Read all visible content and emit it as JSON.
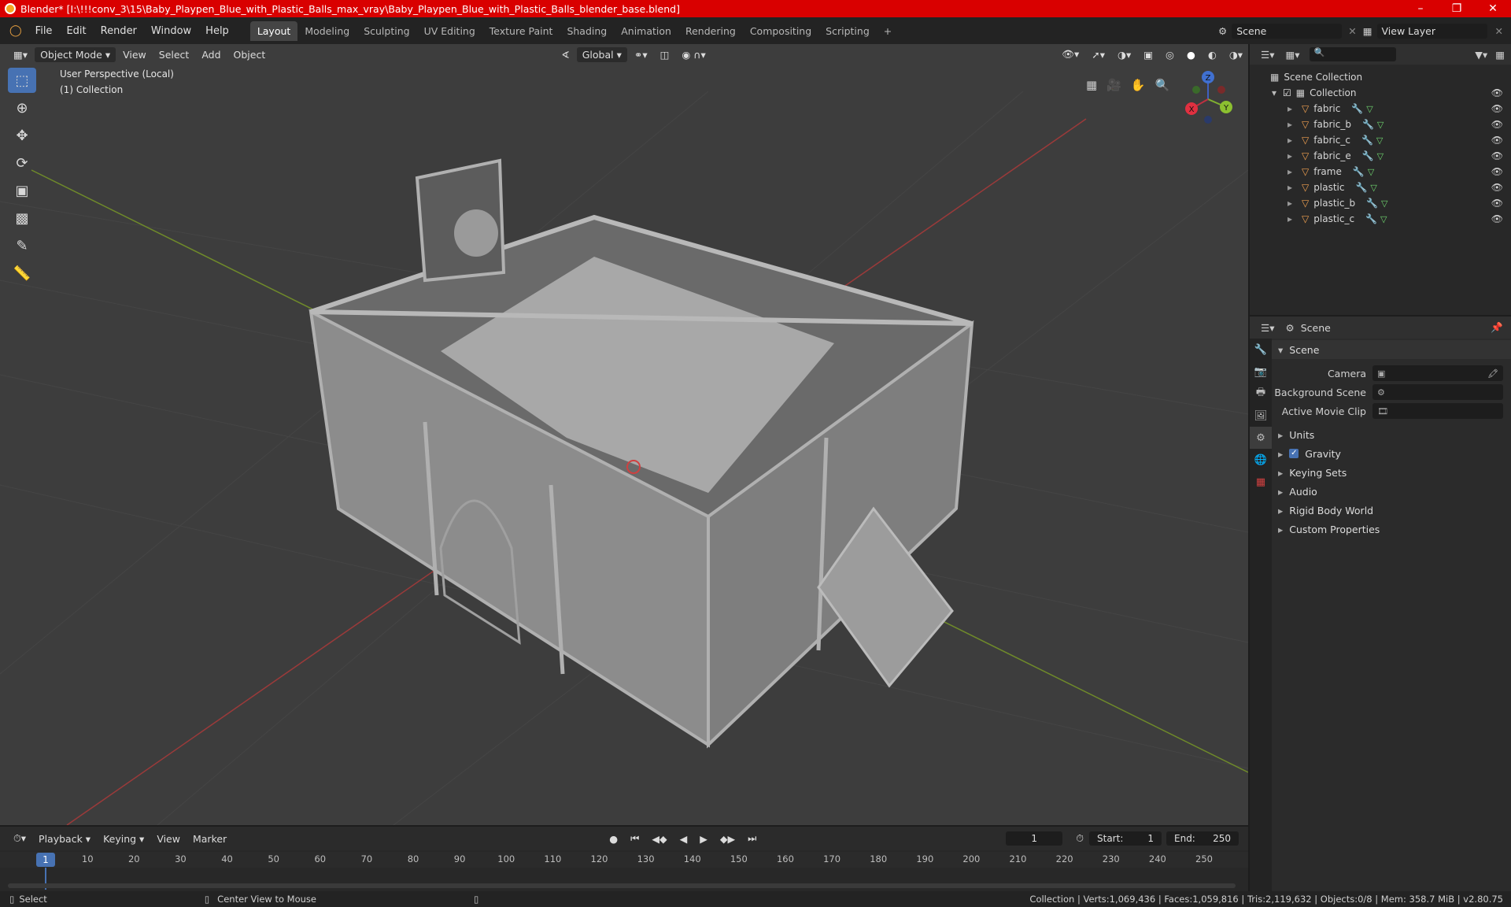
{
  "title": "Blender* [I:\\!!!conv_3\\15\\Baby_Playpen_Blue_with_Plastic_Balls_max_vray\\Baby_Playpen_Blue_with_Plastic_Balls_blender_base.blend]",
  "menu": [
    "File",
    "Edit",
    "Render",
    "Window",
    "Help"
  ],
  "workspaces": [
    "Layout",
    "Modeling",
    "Sculpting",
    "UV Editing",
    "Texture Paint",
    "Shading",
    "Animation",
    "Rendering",
    "Compositing",
    "Scripting"
  ],
  "scene_field": "Scene",
  "view_layer_field": "View Layer",
  "viewport": {
    "mode": "Object Mode",
    "menus": [
      "View",
      "Select",
      "Add",
      "Object"
    ],
    "orientation": "Global",
    "overlay_line1": "User Perspective (Local)",
    "overlay_line2": "(1) Collection",
    "gizmo": {
      "x": "X",
      "y": "Y",
      "z": "Z"
    }
  },
  "outliner": {
    "root": "Scene Collection",
    "collection": "Collection",
    "objects": [
      "fabric",
      "fabric_b",
      "fabric_c",
      "fabric_e",
      "frame",
      "plastic",
      "plastic_b",
      "plastic_c"
    ]
  },
  "properties": {
    "header": "Scene",
    "panel": "Scene",
    "camera_label": "Camera",
    "bg_scene_label": "Background Scene",
    "movie_clip_label": "Active Movie Clip",
    "sections": [
      "Units",
      "Gravity",
      "Keying Sets",
      "Audio",
      "Rigid Body World",
      "Custom Properties"
    ]
  },
  "timeline": {
    "menus": [
      "Playback",
      "Keying",
      "View",
      "Marker"
    ],
    "current_frame": "1",
    "start_label": "Start:",
    "start": "1",
    "end_label": "End:",
    "end": "250",
    "ticks": [
      "10",
      "20",
      "30",
      "40",
      "50",
      "60",
      "70",
      "80",
      "90",
      "100",
      "110",
      "120",
      "130",
      "140",
      "150",
      "160",
      "170",
      "180",
      "190",
      "200",
      "210",
      "220",
      "230",
      "240",
      "250"
    ],
    "playhead": "1"
  },
  "status": {
    "left1": "Select",
    "left2": "Center View to Mouse",
    "right": "Collection | Verts:1,069,436 | Faces:1,059,816 | Tris:2,119,632 | Objects:0/8 | Mem: 358.7 MiB | v2.80.75"
  }
}
